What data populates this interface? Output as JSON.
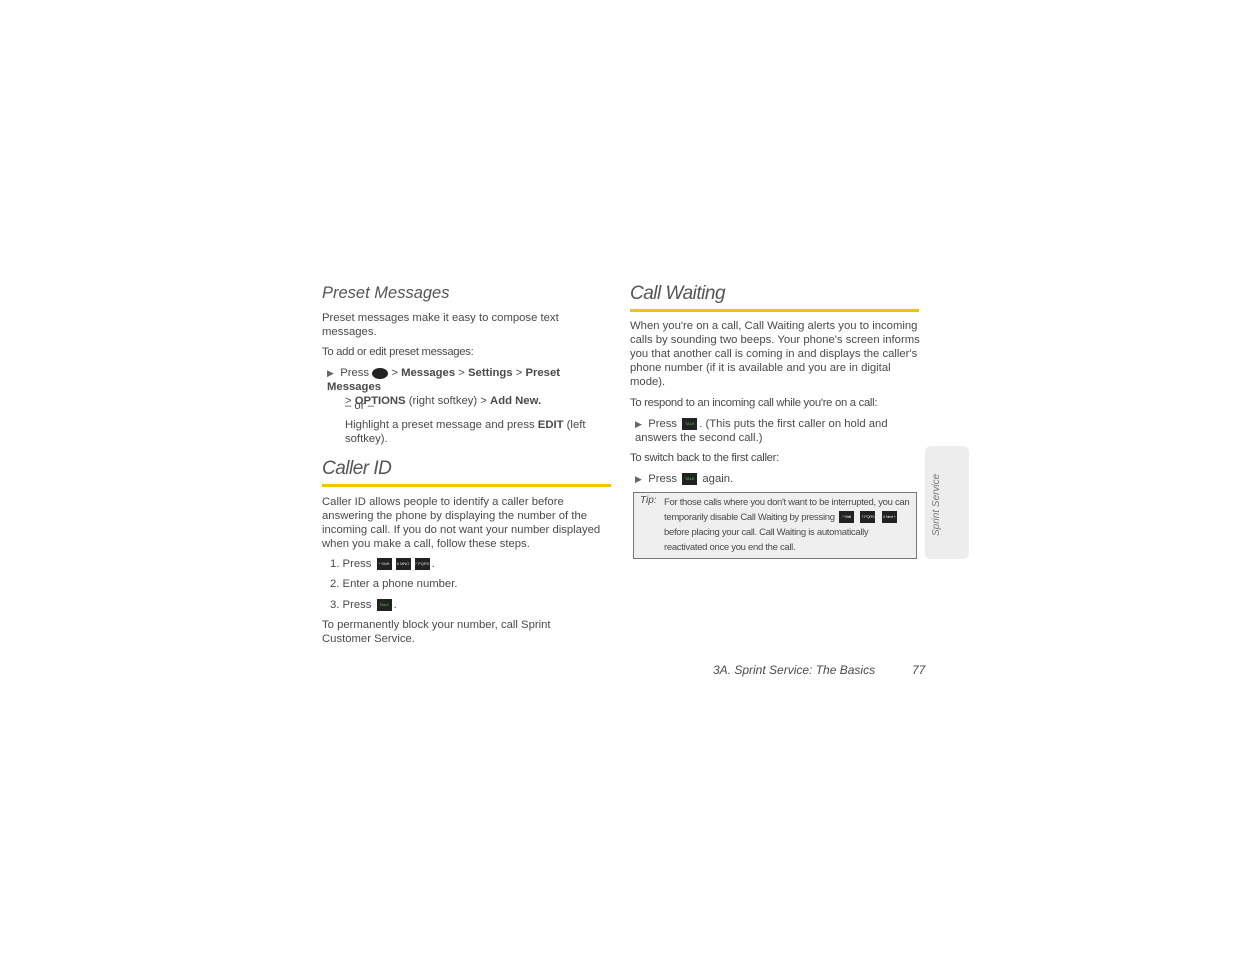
{
  "preset": {
    "heading": "Preset Messages",
    "intro": "Preset messages make it easy to compose text messages.",
    "lead": "To add or edit preset messages:",
    "step_press": "Press",
    "menu": [
      "Messages",
      "Settings",
      "Preset Messages"
    ],
    "options": "OPTIONS",
    "right_softkey": "(right softkey)",
    "add_new": "Add New.",
    "or": "– or –",
    "alt_a": "Highlight a preset message and press",
    "edit": "EDIT",
    "alt_b": "(left softkey)."
  },
  "caller": {
    "heading": "Caller ID",
    "intro": "Caller ID allows people to identify a caller before answering the phone by displaying the number of the incoming call. If you do not want your number displayed when you make a call, follow these steps.",
    "steps": [
      "1. Press",
      "2. Enter a phone number.",
      "3. Press"
    ],
    "keys": [
      "* Shift",
      "6 MNO",
      "7 PQRS"
    ],
    "talk_key": "TALK",
    "outro": "To permanently block your number, call Sprint Customer Service."
  },
  "waiting": {
    "heading": "Call Waiting",
    "intro": "When you're on a call, Call Waiting alerts you to incoming calls by sounding two beeps. Your phone's screen informs you that another call is coming in and displays the caller's phone number (if it is available and you are in digital mode).",
    "lead1": "To respond to an incoming call while you're on a call:",
    "press": "Press",
    "step1": ". (This puts the first caller on hold and answers the second call.)",
    "lead2": "To switch back to the first caller:",
    "again": "again.",
    "tip_label": "Tip:",
    "tip_a": "For those calls where you don't want to be interrupted, you can temporarily disable Call Waiting by pressing",
    "tip_keys": [
      "* Shift",
      "7 PQRS",
      "0 Next +"
    ],
    "tip_b": "before placing your call. Call Waiting is automatically reactivated once you end the call."
  },
  "side_tab": "Sprint Service",
  "footer": {
    "section": "3A. Sprint Service: The Basics",
    "page": "77"
  },
  "colors": {
    "accent": "#f2c500"
  }
}
